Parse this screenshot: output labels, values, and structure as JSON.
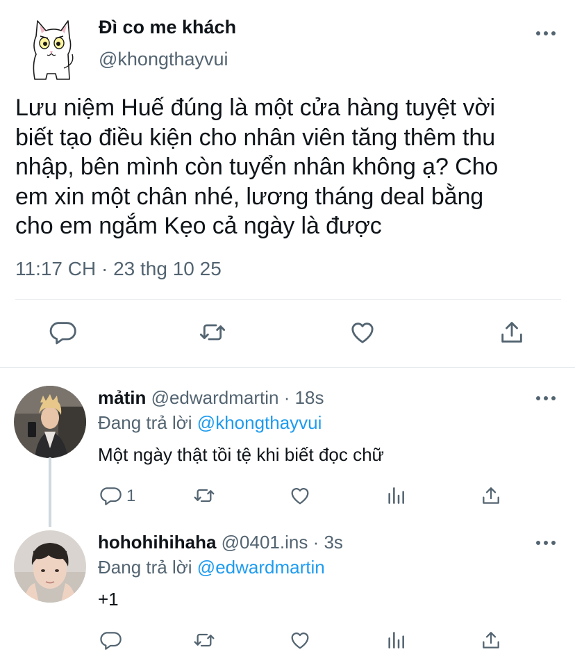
{
  "tweet": {
    "author_name": "Đì co me khách",
    "author_handle": "@khongthayvui",
    "text_lines": [
      "Lưu niệm Huế đúng là một cửa hàng tuyệt vời",
      "biết tạo điều kiện cho nhân viên tăng thêm thu",
      "nhập, bên mình còn tuyển nhân không ạ? Cho",
      "em xin một chân nhé, lương tháng deal bằng",
      "cho em ngắm Kẹo cả ngày là được"
    ],
    "timestamp": "11:17 CH · 23 thg 10 25",
    "actions": [
      "reply-icon",
      "retweet-icon",
      "like-icon",
      "share-icon"
    ]
  },
  "replies": [
    {
      "name": "mảtin",
      "handle": "@edwardmartin · 18s",
      "replying_prefix": "Đang trả lời",
      "replying_to": "@khongthayvui",
      "text": "Một ngày thật tồi tệ khi biết đọc chữ",
      "reply_count": "1"
    },
    {
      "name": "hohohihihaha",
      "handle": "@0401.ins · 3s",
      "replying_prefix": "Đang trả lời",
      "replying_to": "@edwardmartin",
      "text": "+1"
    }
  ],
  "colors": {
    "text": "#0f1419",
    "secondary": "#536471",
    "link": "#1d9bf0",
    "divider": "#e4e8eb"
  }
}
